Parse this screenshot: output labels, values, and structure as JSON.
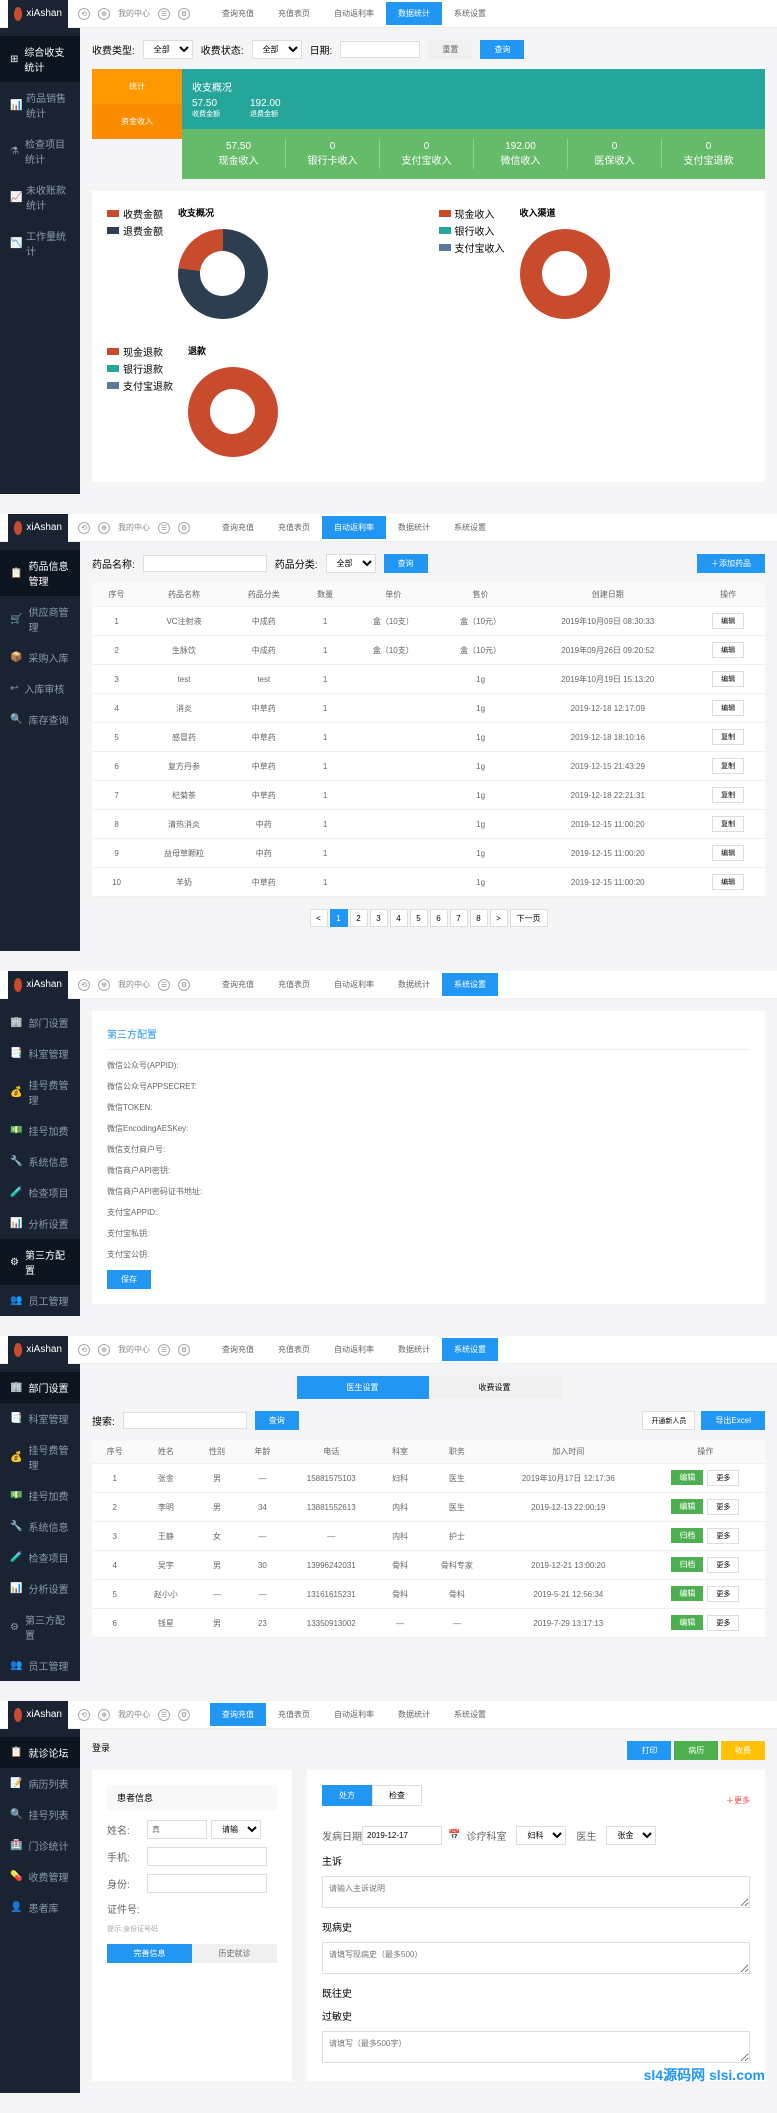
{
  "brand": "xiAshan",
  "watermark": "sl4源码网 slsi.com",
  "topIcons": [
    "⟲",
    "⊕",
    "☰",
    "⚙"
  ],
  "breadcrumb": "我的中心",
  "panel1": {
    "tabs": [
      "查询充值",
      "充值表页",
      "自动返利率",
      "数据统计",
      "系统设置"
    ],
    "activeTab": 3,
    "sidebar": [
      {
        "icon": "⊞",
        "label": "综合收支统计",
        "active": true
      },
      {
        "icon": "📊",
        "label": "药品销售统计"
      },
      {
        "icon": "⚗",
        "label": "检查项目统计"
      },
      {
        "icon": "📈",
        "label": "未收账款统计"
      },
      {
        "icon": "📉",
        "label": "工作量统计"
      }
    ],
    "filters": {
      "l1": "收费类型:",
      "v1": "全部",
      "l2": "收费状态:",
      "v2": "全部",
      "l3": "日期:",
      "btn1": "重置",
      "btn2": "查询"
    },
    "cards": {
      "orange1": "统计",
      "orange2": "资金收入",
      "teal_l1": "收支概况",
      "teal_v1": "57.50",
      "teal_v2": "192.00",
      "teal_l2": "收费金额",
      "teal_l3": "退费金额",
      "green_hdr": "收入渠道",
      "green": [
        {
          "v": "57.50",
          "l": "现金收入"
        },
        {
          "v": "0",
          "l": "银行卡收入"
        },
        {
          "v": "0",
          "l": "支付宝收入"
        },
        {
          "v": "192.00",
          "l": "微信收入"
        },
        {
          "v": "0",
          "l": "医保收入"
        },
        {
          "v": "0",
          "l": "支付宝退款"
        }
      ]
    },
    "chart1": {
      "title": "收支概况",
      "legend": [
        {
          "c": "#c94b2e",
          "t": "收费金额"
        },
        {
          "c": "#2c3e50",
          "t": "退费金额"
        }
      ]
    },
    "chart2": {
      "title": "收入渠道",
      "legend": [
        {
          "c": "#c94b2e",
          "t": "现金收入"
        },
        {
          "c": "#26a69a",
          "t": "银行收入"
        },
        {
          "c": "#5b7a99",
          "t": "支付宝收入"
        }
      ]
    },
    "chart3": {
      "title": "退款",
      "legend": [
        {
          "c": "#c94b2e",
          "t": "现金退款"
        },
        {
          "c": "#26a69a",
          "t": "银行退款"
        },
        {
          "c": "#5b7a99",
          "t": "支付宝退款"
        }
      ]
    },
    "chart_data": [
      {
        "type": "pie",
        "title": "收支概况",
        "series": [
          {
            "name": "收费金额",
            "value": 57.5,
            "color": "#c94b2e"
          },
          {
            "name": "退费金额",
            "value": 192.0,
            "color": "#2c3e50"
          }
        ]
      },
      {
        "type": "pie",
        "title": "收入渠道",
        "series": [
          {
            "name": "现金收入",
            "value": 57.5,
            "color": "#c94b2e"
          },
          {
            "name": "银行收入",
            "value": 0,
            "color": "#26a69a"
          },
          {
            "name": "支付宝收入",
            "value": 0,
            "color": "#5b7a99"
          }
        ]
      },
      {
        "type": "pie",
        "title": "退款",
        "series": [
          {
            "name": "现金退款",
            "value": 192,
            "color": "#c94b2e"
          },
          {
            "name": "银行退款",
            "value": 0,
            "color": "#26a69a"
          },
          {
            "name": "支付宝退款",
            "value": 0,
            "color": "#5b7a99"
          }
        ]
      }
    ]
  },
  "panel2": {
    "tabs": [
      "查询充值",
      "充值表页",
      "自动返利率",
      "数据统计",
      "系统设置"
    ],
    "activeTab": 2,
    "sidebar": [
      {
        "icon": "📋",
        "label": "药品信息管理",
        "active": true
      },
      {
        "icon": "🛒",
        "label": "供应商管理"
      },
      {
        "icon": "📦",
        "label": "采购入库"
      },
      {
        "icon": "↩",
        "label": "入库审核"
      },
      {
        "icon": "🔍",
        "label": "库存查询"
      }
    ],
    "search": {
      "l1": "药品名称:",
      "l2": "药品分类:",
      "v2": "全部",
      "btn": "查询",
      "addBtn": "＋添加药品"
    },
    "headers": [
      "序号",
      "药品名称",
      "药品分类",
      "数量",
      "单价",
      "售价",
      "创建日期",
      "操作"
    ],
    "rows": [
      [
        "1",
        "VC注射液",
        "中成药",
        "1",
        "盒（10支）",
        "盒（10元）",
        "2019年10月09日 08:30:33",
        "编辑"
      ],
      [
        "2",
        "生脉饮",
        "中成药",
        "1",
        "盒（10支）",
        "盒（10元）",
        "2019年09月26日 09:20:52",
        "编辑"
      ],
      [
        "3",
        "test",
        "test",
        "1",
        "",
        "1g",
        "2019年10月19日 15:13:20",
        "编辑"
      ],
      [
        "4",
        "消炎",
        "中草药",
        "1",
        "",
        "1g",
        "2019-12-18 12:17:09",
        "编辑"
      ],
      [
        "5",
        "感冒药",
        "中草药",
        "1",
        "",
        "1g",
        "2019-12-18 18:10:16",
        "复制"
      ],
      [
        "6",
        "复方丹参",
        "中草药",
        "1",
        "",
        "1g",
        "2019-12-15 21:43:29",
        "复制"
      ],
      [
        "7",
        "杞菊茶",
        "中草药",
        "1",
        "",
        "1g",
        "2019-12-18 22:21:31",
        "复制"
      ],
      [
        "8",
        "清热消炎",
        "中药",
        "1",
        "",
        "1g",
        "2019-12-15 11:00:20",
        "复制"
      ],
      [
        "9",
        "益母草颗粒",
        "中药",
        "1",
        "",
        "1g",
        "2019-12-15 11:00:20",
        "编辑"
      ],
      [
        "10",
        "羊奶",
        "中草药",
        "1",
        "",
        "1g",
        "2019-12-15 11:00:20",
        "编辑"
      ]
    ],
    "pages": [
      "<",
      "1",
      "2",
      "3",
      "4",
      "5",
      "6",
      "7",
      "8",
      ">",
      "下一页"
    ]
  },
  "panel3": {
    "tabs": [
      "查询充值",
      "充值表页",
      "自动返利率",
      "数据统计",
      "系统设置"
    ],
    "activeTab": 4,
    "sidebar": [
      {
        "icon": "🏢",
        "label": "部门设置"
      },
      {
        "icon": "📑",
        "label": "科室管理"
      },
      {
        "icon": "💰",
        "label": "挂号费管理"
      },
      {
        "icon": "💵",
        "label": "挂号加费"
      },
      {
        "icon": "🔧",
        "label": "系统信息"
      },
      {
        "icon": "🧪",
        "label": "检查项目"
      },
      {
        "icon": "📊",
        "label": "分析设置"
      },
      {
        "icon": "⚙",
        "label": "第三方配置",
        "active": true
      },
      {
        "icon": "👥",
        "label": "员工管理"
      }
    ],
    "title": "第三方配置",
    "fields": [
      "微信公众号(APPID):",
      "微信公众号APPSECRET:",
      "微信TOKEN:",
      "微信EncodingAESKey:",
      "微信支付商户号:",
      "微信商户API密钥:",
      "微信商户API密码证书地址:",
      "支付宝APPID:",
      "支付宝私钥:",
      "支付宝公钥:"
    ],
    "saveBtn": "保存"
  },
  "panel4": {
    "tabs": [
      "查询充值",
      "充值表页",
      "自动返利率",
      "数据统计",
      "系统设置"
    ],
    "activeTab": 4,
    "sidebar": [
      {
        "icon": "🏢",
        "label": "部门设置",
        "active": true
      },
      {
        "icon": "📑",
        "label": "科室管理"
      },
      {
        "icon": "💰",
        "label": "挂号费管理"
      },
      {
        "icon": "💵",
        "label": "挂号加费"
      },
      {
        "icon": "🔧",
        "label": "系统信息"
      },
      {
        "icon": "🧪",
        "label": "检查项目"
      },
      {
        "icon": "📊",
        "label": "分析设置"
      },
      {
        "icon": "⚙",
        "label": "第三方配置"
      },
      {
        "icon": "👥",
        "label": "员工管理"
      }
    ],
    "switchTabs": [
      "医生设置",
      "收费设置"
    ],
    "search": {
      "l": "搜索:",
      "btn": "查询",
      "btn2": "开通新人员",
      "btn3": "导出Excel"
    },
    "headers": [
      "序号",
      "姓名",
      "性别",
      "年龄",
      "电话",
      "科室",
      "职务",
      "加入时间",
      "操作"
    ],
    "rows": [
      [
        "1",
        "张金",
        "男",
        "—",
        "15881575103",
        "妇科",
        "医生",
        "2019年10月17日 12:17:36",
        "编辑",
        "更多"
      ],
      [
        "2",
        "李明",
        "男",
        "34",
        "13881552613",
        "内科",
        "医生",
        "2019-12-13 22:00:19",
        "编辑",
        "更多"
      ],
      [
        "3",
        "王静",
        "女",
        "—",
        "—",
        "内科",
        "护士",
        "",
        "归档",
        "更多"
      ],
      [
        "4",
        "吴宇",
        "男",
        "30",
        "13996242031",
        "骨科",
        "骨科专家",
        "2019-12-21 13:00:20",
        "归档",
        "更多"
      ],
      [
        "5",
        "赵小小",
        "—",
        "—",
        "13161615231",
        "骨科",
        "骨科",
        "2019-5-21 12:56:34",
        "编辑",
        "更多"
      ],
      [
        "6",
        "钱星",
        "男",
        "23",
        "13350913002",
        "—",
        "—",
        "2019-7-29 13:17:13",
        "编辑",
        "更多"
      ]
    ]
  },
  "panel5": {
    "tabs": [
      "查询充值",
      "充值表页",
      "自动返利率",
      "数据统计",
      "系统设置"
    ],
    "activeTab": 0,
    "sidebar": [
      {
        "icon": "📋",
        "label": "就诊论坛",
        "active": true
      },
      {
        "icon": "📝",
        "label": "病历列表"
      },
      {
        "icon": "🔍",
        "label": "挂号列表"
      },
      {
        "icon": "🏥",
        "label": "门诊统计"
      },
      {
        "icon": "💊",
        "label": "收费管理"
      },
      {
        "icon": "👤",
        "label": "患者库"
      }
    ],
    "pageTitle": "登录",
    "topBtns": [
      "打印",
      "病历",
      "收费"
    ],
    "leftTitle": "患者信息",
    "leftFields": [
      {
        "l": "姓名:",
        "ph": "真"
      },
      {
        "l": "",
        "ph": "请输入..."
      },
      {
        "l": "手机:",
        "ph": ""
      },
      {
        "l": "身份:",
        "ph": ""
      },
      {
        "l": "证件号:",
        "note": "提示:身份证号码"
      }
    ],
    "leftBtns": [
      "完善信息",
      "历史就诊"
    ],
    "rightTabs": [
      "处方",
      "检查"
    ],
    "moreBtn": "＋更多",
    "rightFields": [
      {
        "l": "发病日期",
        "v": "2019-12-17",
        "l2": "诊疗科室",
        "v2": "妇科",
        "l3": "医生",
        "v3": "张金"
      },
      {
        "l": "主诉"
      },
      {
        "l": "",
        "ph": "请输入主诉说明"
      },
      {
        "l": "现病史"
      },
      {
        "l": "",
        "ph": "请填写现病史（最多500）"
      },
      {
        "l": "既往史"
      },
      {
        "l": "过敏史"
      },
      {
        "l": "",
        "ph": "请填写（最多500字）"
      }
    ]
  }
}
